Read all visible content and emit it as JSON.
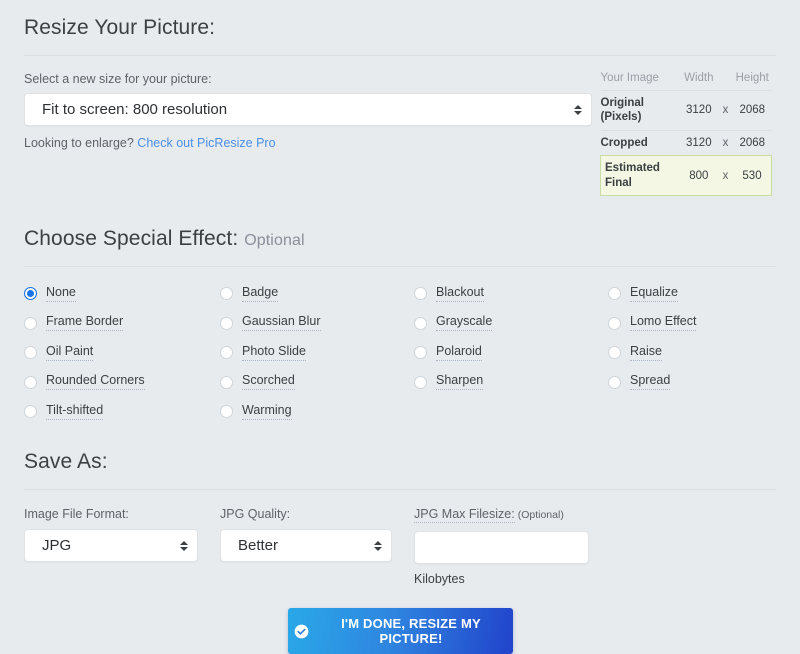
{
  "resize": {
    "heading": "Resize Your Picture:",
    "select_label": "Select a new size for your picture:",
    "selected_size": "Fit to screen: 800 resolution",
    "enlarge_text": "Looking to enlarge?",
    "enlarge_link": "Check out PicResize Pro"
  },
  "info_table": {
    "headers": [
      "Your Image",
      "Width",
      "Height"
    ],
    "x_symbol": "x",
    "rows": [
      {
        "label": "Original (Pixels)",
        "width": "3120",
        "height": "2068",
        "highlight": false
      },
      {
        "label": "Cropped",
        "width": "3120",
        "height": "2068",
        "highlight": false
      },
      {
        "label": "Estimated Final",
        "width": "800",
        "height": "530",
        "highlight": true
      }
    ]
  },
  "effects": {
    "heading": "Choose Special Effect:",
    "optional": "Optional",
    "items": [
      {
        "label": "None",
        "checked": true
      },
      {
        "label": "Badge",
        "checked": false
      },
      {
        "label": "Blackout",
        "checked": false
      },
      {
        "label": "Equalize",
        "checked": false
      },
      {
        "label": "Frame Border",
        "checked": false
      },
      {
        "label": "Gaussian Blur",
        "checked": false
      },
      {
        "label": "Grayscale",
        "checked": false
      },
      {
        "label": "Lomo Effect",
        "checked": false
      },
      {
        "label": "Oil Paint",
        "checked": false
      },
      {
        "label": "Photo Slide",
        "checked": false
      },
      {
        "label": "Polaroid",
        "checked": false
      },
      {
        "label": "Raise",
        "checked": false
      },
      {
        "label": "Rounded Corners",
        "checked": false
      },
      {
        "label": "Scorched",
        "checked": false
      },
      {
        "label": "Sharpen",
        "checked": false
      },
      {
        "label": "Spread",
        "checked": false
      },
      {
        "label": "Tilt-shifted",
        "checked": false
      },
      {
        "label": "Warming",
        "checked": false
      }
    ]
  },
  "save_as": {
    "heading": "Save As:",
    "format_label": "Image File Format:",
    "format_value": "JPG",
    "quality_label": "JPG Quality:",
    "quality_value": "Better",
    "filesize_label": "JPG Max Filesize:",
    "filesize_optional": "(Optional)",
    "filesize_value": "",
    "filesize_placeholder": "",
    "filesize_unit": "Kilobytes"
  },
  "submit": {
    "label": "I'M DONE, RESIZE MY PICTURE!",
    "icon": "check-circle-icon"
  },
  "colors": {
    "background": "#e7ebee",
    "accent_blue": "#1a73e8",
    "link_blue": "#4a90e8",
    "highlight_bg": "#f3f7e3",
    "highlight_border": "#c9dca2",
    "button_gradient_start": "#29a8e8",
    "button_gradient_end": "#2143cb"
  }
}
